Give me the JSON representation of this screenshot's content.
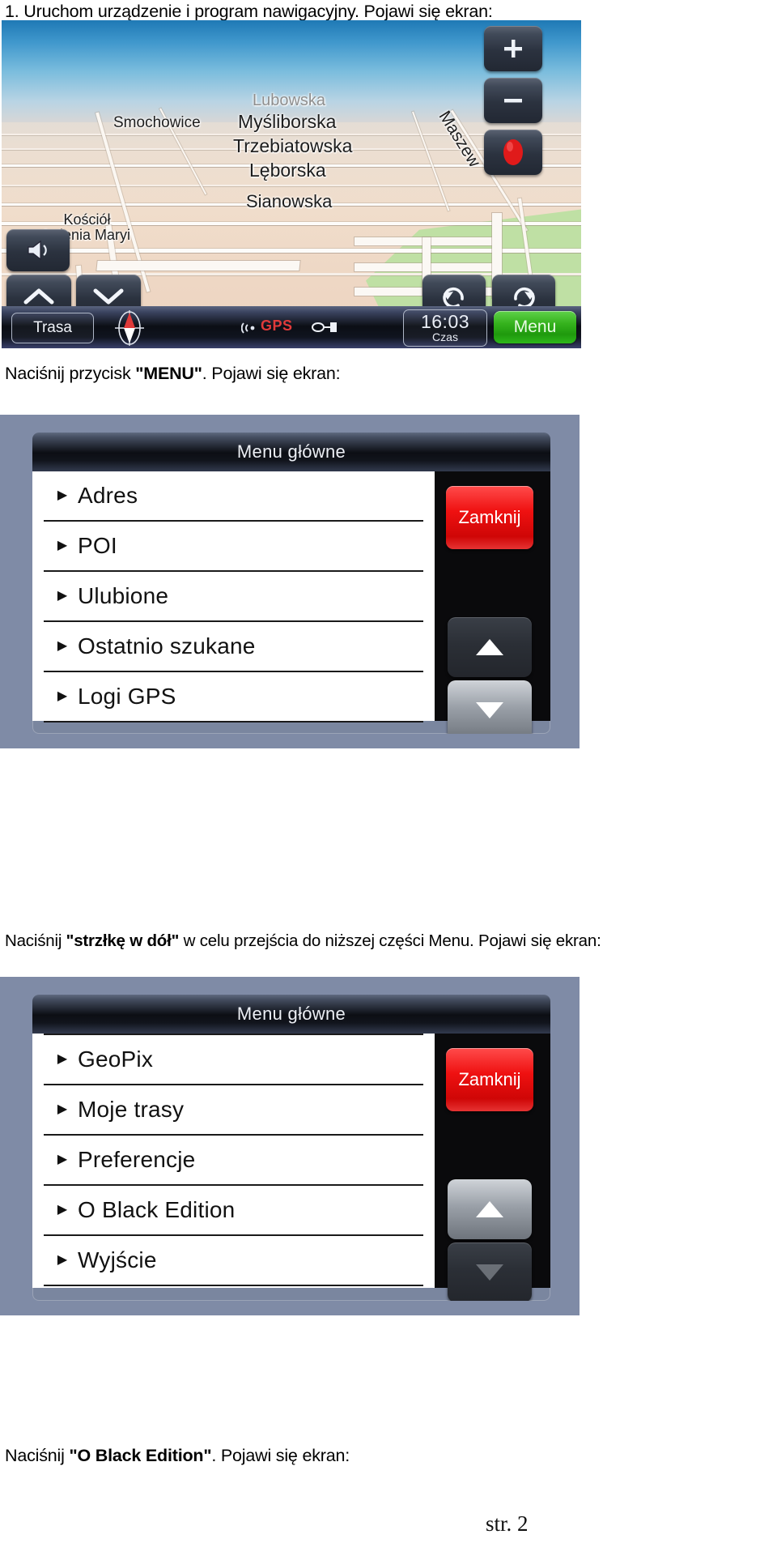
{
  "page": {
    "number_label": "str. 2"
  },
  "steps": [
    {
      "id": "step1",
      "html": "1. Uruchom urządzenie i program nawigacyjny. Pojawi się ekran:",
      "plain": "1. Uruchom urządzenie i program nawigacyjny. Pojawi się ekran:"
    },
    {
      "id": "step2",
      "pre": "Naciśnij przycisk ",
      "bold": "\"MENU\"",
      "post": ". Pojawi się ekran:"
    },
    {
      "id": "step3",
      "pre": "Naciśnij ",
      "bold": "\"strzłkę w dół\"",
      "post": " w celu przejścia do niższej części Menu. Pojawi się ekran:"
    },
    {
      "id": "step4",
      "pre": "Naciśnij ",
      "bold": "\"O Black Edition\"",
      "post": ". Pojawi się ekran:"
    }
  ],
  "map_screen": {
    "street_labels": [
      {
        "text": "Smochowice",
        "size": 19,
        "faded": false
      },
      {
        "text": "Lubowska",
        "size": 20,
        "faded": true
      },
      {
        "text": "Myśliborska",
        "size": 23,
        "faded": false
      },
      {
        "text": "Trzebiatowska",
        "size": 23,
        "faded": false
      },
      {
        "text": "Lęborska",
        "size": 23,
        "faded": false
      },
      {
        "text": "Sianowska",
        "size": 22,
        "faded": false
      },
      {
        "text": "Maszew",
        "size": 21,
        "faded": false
      }
    ],
    "poi_label_line1": "Kościół",
    "poi_label_line2": "Imienia Maryi",
    "buttons": {
      "zoom_in": "+",
      "zoom_out": "−",
      "record": "record-dot",
      "volume": "speaker-icon",
      "tilt_up": "chevron-up-icon",
      "tilt_down": "chevron-down-icon",
      "rotate_left": "rotate-ccw-icon",
      "rotate_right": "rotate-cw-icon"
    },
    "status_bar": {
      "route_button": "Trasa",
      "compass": "compass-needle",
      "gps_label": "GPS",
      "gps_signal_icon": "signal-waves-icon",
      "power_icon": "plug-icon",
      "clock_time": "16:03",
      "clock_caption": "Czas",
      "menu_button": "Menu"
    },
    "colors": {
      "menu_button_green": "#2eb81b",
      "gps_red": "#e03a3a",
      "record_red": "#e01a1a",
      "sky_blue": "#1f79b5",
      "ground_tan": "#f0ddcb",
      "park_green": "#bfe0a4"
    }
  },
  "menu_screen_1": {
    "title": "Menu główne",
    "items": [
      {
        "label": "Adres"
      },
      {
        "label": "POI"
      },
      {
        "label": "Ulubione"
      },
      {
        "label": "Ostatnio szukane"
      },
      {
        "label": "Logi GPS"
      }
    ],
    "close_button": "Zamknij",
    "scroll_up": "scroll-up-arrow",
    "scroll_down": "scroll-down-arrow",
    "scroll_up_state": "dark",
    "scroll_down_state": "light",
    "colors": {
      "close_red": "#ef1111",
      "bezel": "#7f8ba6"
    }
  },
  "menu_screen_2": {
    "title": "Menu główne",
    "items": [
      {
        "label": "GeoPix"
      },
      {
        "label": "Moje trasy"
      },
      {
        "label": "Preferencje"
      },
      {
        "label": "O Black Edition"
      },
      {
        "label": "Wyjście"
      }
    ],
    "close_button": "Zamknij",
    "scroll_up": "scroll-up-arrow",
    "scroll_down": "scroll-down-arrow",
    "scroll_up_state": "light",
    "scroll_down_state": "dark",
    "colors": {
      "close_red": "#ef1111",
      "bezel": "#7f8ba6"
    }
  }
}
